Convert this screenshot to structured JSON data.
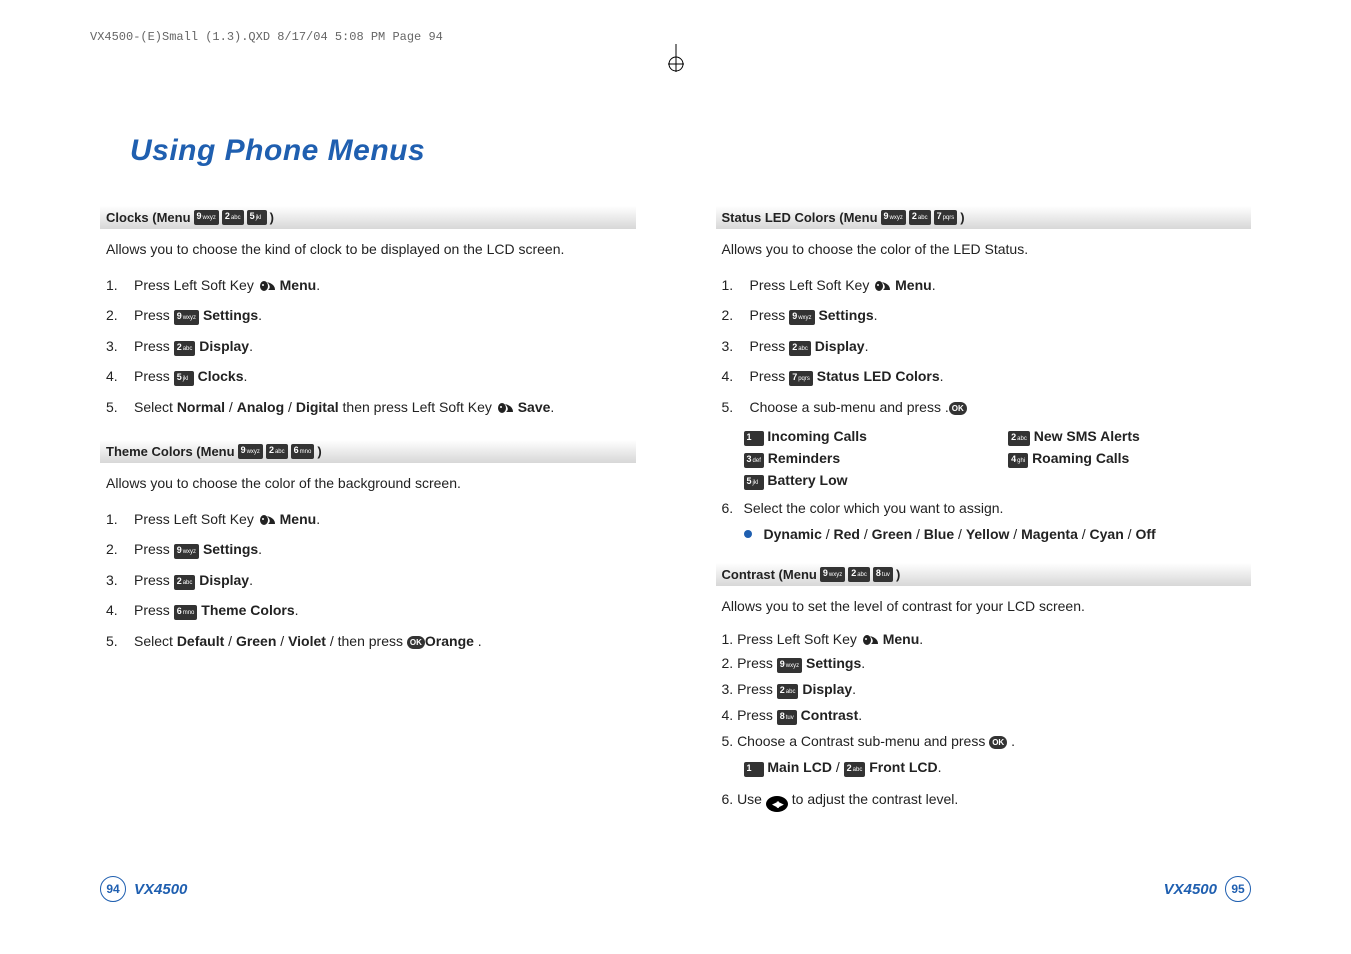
{
  "runningHead": "VX4500-(E)Small (1.3).QXD  8/17/04  5:08 PM  Page 94",
  "title": "Using Phone Menus",
  "keys": {
    "1": {
      "n": "1",
      "s": ""
    },
    "2": {
      "n": "2",
      "s": "abc"
    },
    "3": {
      "n": "3",
      "s": "def"
    },
    "4": {
      "n": "4",
      "s": "ghi"
    },
    "5": {
      "n": "5",
      "s": "jkl"
    },
    "6": {
      "n": "6",
      "s": "mno"
    },
    "7": {
      "n": "7",
      "s": "pqrs"
    },
    "8": {
      "n": "8",
      "s": "tuv"
    },
    "9": {
      "n": "9",
      "s": "wxyz"
    }
  },
  "ok": "OK",
  "left": {
    "sections": [
      {
        "head_pre": "Clocks (Menu ",
        "head_keys": [
          "9",
          "2",
          "5"
        ],
        "head_post": " )",
        "intro": "Allows you to choose the kind of clock to be displayed on the LCD screen.",
        "steps": [
          {
            "t": "Press Left Soft Key ",
            "soft": true,
            "after": " ",
            "bold": "Menu",
            "end": "."
          },
          {
            "t": "Press ",
            "key": "9",
            "after": " ",
            "bold": "Settings",
            "end": "."
          },
          {
            "t": "Press ",
            "key": "2",
            "after": " ",
            "bold": "Display",
            "end": "."
          },
          {
            "t": "Press ",
            "key": "5",
            "after": " ",
            "bold": "Clocks",
            "end": "."
          },
          {
            "t": "Select ",
            "bold": "Normal",
            "end": " / ",
            "bold2": "Analog",
            "end2": " / ",
            "bold3": "Digital",
            "tail": " then press Left Soft Key ",
            "soft2": true,
            "bold4": "Save",
            "end4": "."
          }
        ]
      },
      {
        "head_pre": "Theme Colors (Menu ",
        "head_keys": [
          "9",
          "2",
          "6"
        ],
        "head_post": " )",
        "intro": "Allows you to choose the color of the background screen.",
        "steps": [
          {
            "t": "Press Left Soft Key ",
            "soft": true,
            "after": " ",
            "bold": "Menu",
            "end": "."
          },
          {
            "t": "Press ",
            "key": "9",
            "after": " ",
            "bold": "Settings",
            "end": "."
          },
          {
            "t": "Press ",
            "key": "2",
            "after": " ",
            "bold": "Display",
            "end": "."
          },
          {
            "t": "Press ",
            "key": "6",
            "after": " ",
            "bold": "Theme Colors",
            "end": "."
          },
          {
            "t": "Select ",
            "bold": "Default",
            "end": " / ",
            "bold2": "Green",
            "end2": " / ",
            "bold3": "Violet",
            "end3": " / ",
            "bold4": "Orange",
            "tail": " then press ",
            "ok": true,
            "end4": " ."
          }
        ]
      }
    ]
  },
  "right": {
    "sections": [
      {
        "head_pre": "Status LED Colors (Menu ",
        "head_keys": [
          "9",
          "2",
          "7"
        ],
        "head_post": " )",
        "intro": "Allows you to choose the color of the LED Status.",
        "steps": [
          {
            "t": "Press Left Soft Key ",
            "soft": true,
            "after": " ",
            "bold": "Menu",
            "end": "."
          },
          {
            "t": "Press ",
            "key": "9",
            "after": " ",
            "bold": "Settings",
            "end": "."
          },
          {
            "t": "Press ",
            "key": "2",
            "after": " ",
            "bold": "Display",
            "end": "."
          },
          {
            "t": "Press ",
            "key": "7",
            "after": " ",
            "bold": "Status LED Colors",
            "end": "."
          },
          {
            "t": "Choose a sub-menu and press ",
            "ok": true,
            "end": " ."
          }
        ],
        "subgrid": [
          {
            "k": "1",
            "label": "Incoming Calls"
          },
          {
            "k": "2",
            "label": "New SMS Alerts"
          },
          {
            "k": "3",
            "label": "Reminders"
          },
          {
            "k": "4",
            "label": "Roaming Calls"
          },
          {
            "k": "5",
            "label": "Battery Low"
          }
        ],
        "steps2": [
          {
            "n": "6.",
            "t": "Select the color which you want to assign."
          }
        ],
        "bullet": "Dynamic / Red / Green / Blue / Yellow / Magenta / Cyan / Off"
      },
      {
        "head_pre": "Contrast (Menu ",
        "head_keys": [
          "9",
          "2",
          "8"
        ],
        "head_post": " )",
        "intro": "Allows you to set the level of contrast for your LCD screen.",
        "steps_inline": [
          {
            "pre": "1. Press Left Soft Key ",
            "soft": true,
            "bold": "Menu",
            "end": "."
          },
          {
            "pre": "2. Press ",
            "key": "9",
            "bold": "Settings",
            "end": "."
          },
          {
            "pre": "3. Press ",
            "key": "2",
            "bold": "Display",
            "end": "."
          },
          {
            "pre": "4. Press ",
            "key": "8",
            "bold": "Contrast",
            "end": "."
          },
          {
            "pre": "5. Choose a Contrast sub-menu and press ",
            "ok": true,
            "end": " ."
          }
        ],
        "subline_parts": {
          "a": "Main LCD",
          "b": "Front LCD",
          "k1": "1",
          "k2": "2"
        },
        "step6_pre": "6. Use ",
        "step6_post": " to adjust the contrast level."
      }
    ]
  },
  "footer": {
    "model": "VX4500",
    "pL": "94",
    "pR": "95"
  }
}
